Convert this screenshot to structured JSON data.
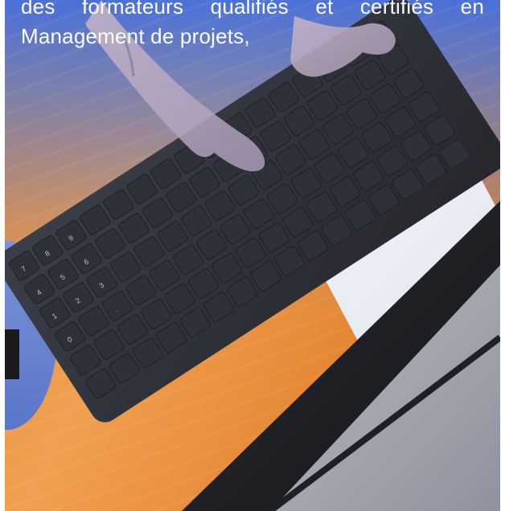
{
  "promo": {
    "text_line_1": "des formateurs qualifiés et certifiés en",
    "text_line_2": "Management de projets,"
  },
  "colors": {
    "overlay_blue": "#3c6ee6",
    "desk_orange": "#e48a3a",
    "keyboard_dark": "#2b2d33",
    "text_white": "#ffffff"
  },
  "icons": {
    "keyboard": "keyboard-image",
    "hands": "typing-hands-image",
    "laptop": "laptop-image"
  }
}
